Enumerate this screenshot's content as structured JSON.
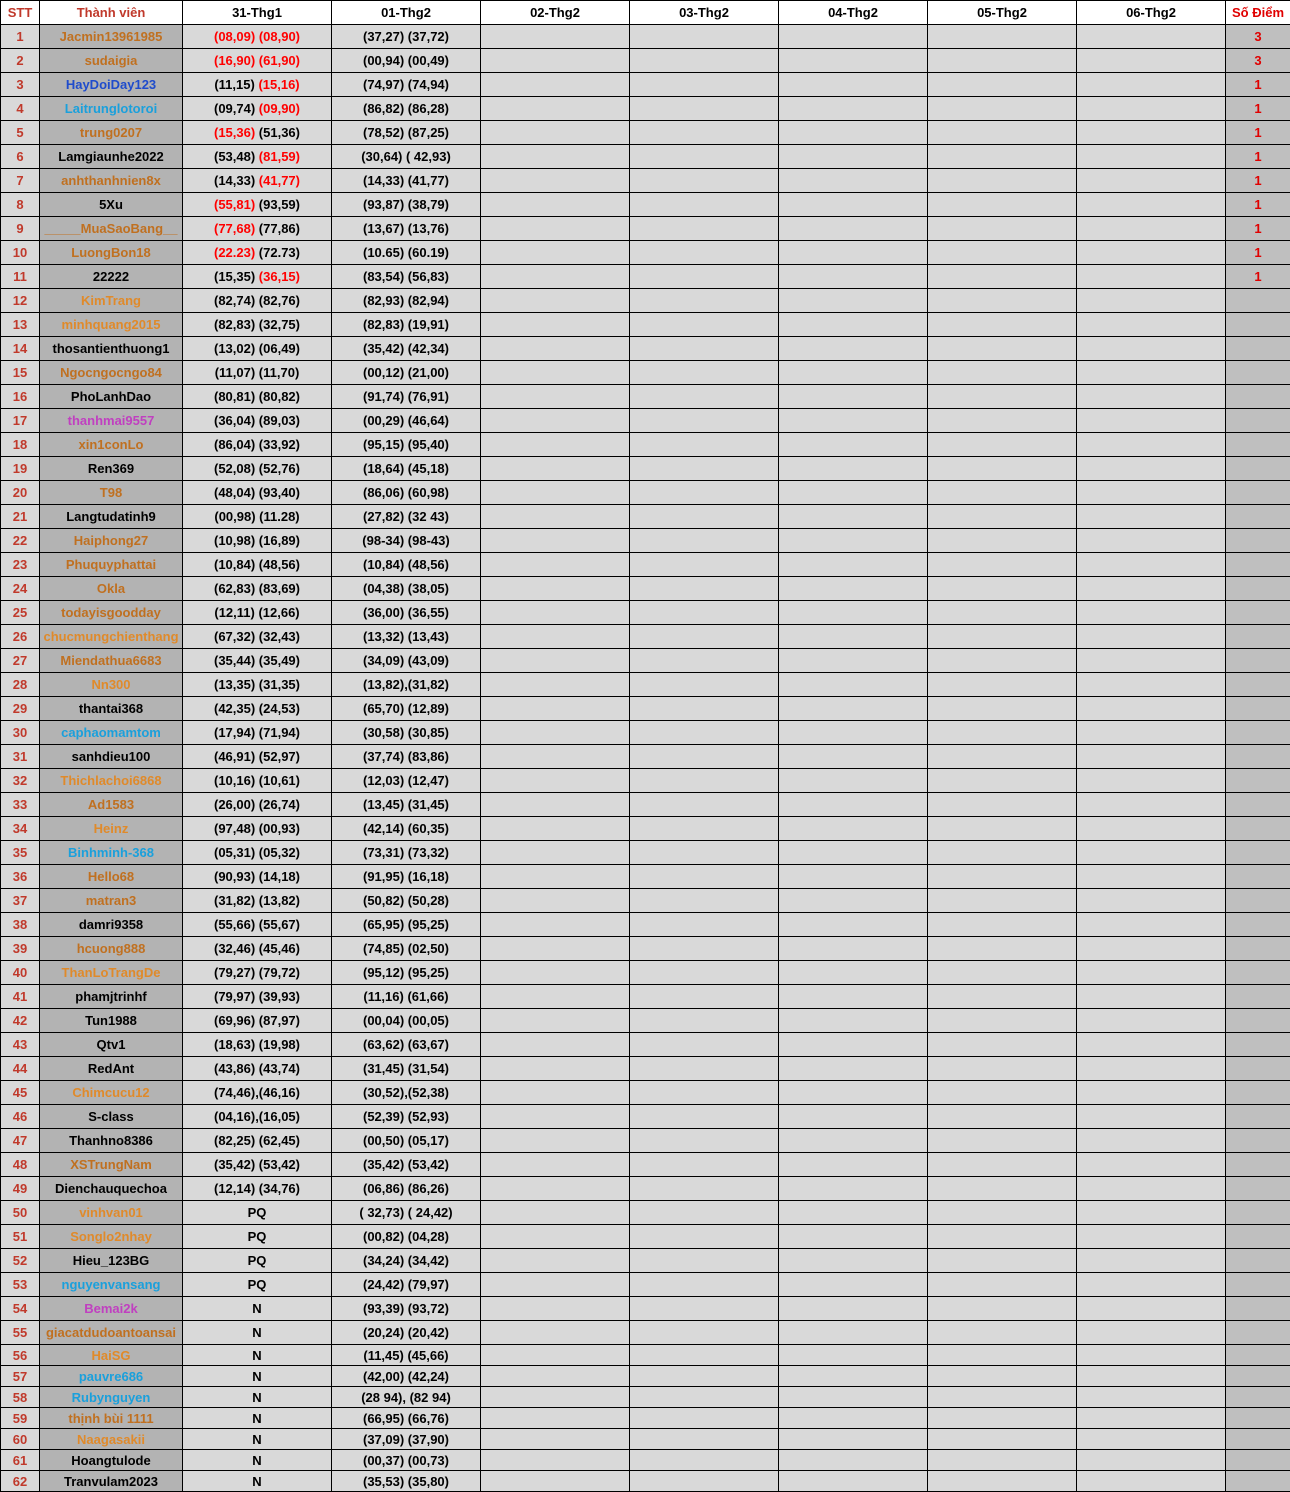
{
  "colors": {
    "stt": "#c0392b",
    "orange": "#c07020",
    "light_orange": "#e08a2a",
    "blue": "#1f4ccc",
    "cyan": "#1aa0dc",
    "magenta": "#c040c0",
    "black": "#000000",
    "red": "#ff0000"
  },
  "headers": [
    "STT",
    "Thành viên",
    "31-Thg1",
    "01-Thg2",
    "02-Thg2",
    "03-Thg2",
    "04-Thg2",
    "05-Thg2",
    "06-Thg2",
    "Số Điểm"
  ],
  "rows": [
    {
      "stt": "1",
      "name": "Jacmin13961985",
      "color": "orange",
      "d1": [
        {
          "t": "(08,09)",
          "r": true
        },
        {
          "t": " "
        },
        {
          "t": "(08,90)",
          "r": true
        }
      ],
      "d2": "(37,27) (37,72)",
      "pts": "3"
    },
    {
      "stt": "2",
      "name": "sudaigia",
      "color": "orange",
      "d1": [
        {
          "t": "(16,90) (61,90)",
          "r": true
        }
      ],
      "d2": "(00,94) (00,49)",
      "pts": "3"
    },
    {
      "stt": "3",
      "name": "HayDoiDay123",
      "color": "blue",
      "d1": [
        {
          "t": "(11,15) "
        },
        {
          "t": "(15,16)",
          "r": true
        }
      ],
      "d2": "(74,97) (74,94)",
      "pts": "1"
    },
    {
      "stt": "4",
      "name": "Laitrunglotoroi",
      "color": "cyan",
      "d1": [
        {
          "t": "(09,74) "
        },
        {
          "t": "(09,90)",
          "r": true
        }
      ],
      "d2": "(86,82) (86,28)",
      "pts": "1"
    },
    {
      "stt": "5",
      "name": "trung0207",
      "color": "orange",
      "d1": [
        {
          "t": "(15,36)",
          "r": true
        },
        {
          "t": " (51,36)"
        }
      ],
      "d2": "(78,52) (87,25)",
      "pts": "1"
    },
    {
      "stt": "6",
      "name": "Lamgiaunhe2022",
      "color": "black",
      "d1": [
        {
          "t": "(53,48) "
        },
        {
          "t": "(81,59)",
          "r": true
        }
      ],
      "d2": "(30,64) ( 42,93)",
      "pts": "1"
    },
    {
      "stt": "7",
      "name": "anhthanhnien8x",
      "color": "orange",
      "d1": [
        {
          "t": "(14,33) "
        },
        {
          "t": "(41,77)",
          "r": true
        }
      ],
      "d2": "(14,33) (41,77)",
      "pts": "1"
    },
    {
      "stt": "8",
      "name": "5Xu",
      "color": "black",
      "d1": [
        {
          "t": "(55,81)",
          "r": true
        },
        {
          "t": " (93,59)"
        }
      ],
      "d2": "(93,87) (38,79)",
      "pts": "1"
    },
    {
      "stt": "9",
      "name": "_____MuaSaoBang__",
      "color": "orange",
      "d1": [
        {
          "t": "(77,68)",
          "r": true
        },
        {
          "t": " (77,86)"
        }
      ],
      "d2": "(13,67) (13,76)",
      "pts": "1"
    },
    {
      "stt": "10",
      "name": "LuongBon18",
      "color": "orange",
      "d1": [
        {
          "t": "(22.23)",
          "r": true
        },
        {
          "t": " (72.73)"
        }
      ],
      "d2": "(10.65) (60.19)",
      "pts": "1"
    },
    {
      "stt": "11",
      "name": "22222",
      "color": "black",
      "d1": [
        {
          "t": "(15,35) "
        },
        {
          "t": "(36,15)",
          "r": true
        }
      ],
      "d2": "(83,54) (56,83)",
      "pts": "1"
    },
    {
      "stt": "12",
      "name": "KimTrang",
      "color": "light_orange",
      "d1": [
        {
          "t": "(82,74) (82,76)"
        }
      ],
      "d2": "(82,93) (82,94)",
      "pts": ""
    },
    {
      "stt": "13",
      "name": "minhquang2015",
      "color": "light_orange",
      "d1": [
        {
          "t": "(82,83) (32,75)"
        }
      ],
      "d2": "(82,83) (19,91)",
      "pts": ""
    },
    {
      "stt": "14",
      "name": "thosantienthuong1",
      "color": "black",
      "d1": [
        {
          "t": "(13,02) (06,49)"
        }
      ],
      "d2": "(35,42) (42,34)",
      "pts": ""
    },
    {
      "stt": "15",
      "name": "Ngocngocngo84",
      "color": "orange",
      "d1": [
        {
          "t": "(11,07) (11,70)"
        }
      ],
      "d2": "(00,12) (21,00)",
      "pts": ""
    },
    {
      "stt": "16",
      "name": "PhoLanhDao",
      "color": "black",
      "d1": [
        {
          "t": "(80,81) (80,82)"
        }
      ],
      "d2": "(91,74) (76,91)",
      "pts": ""
    },
    {
      "stt": "17",
      "name": "thanhmai9557",
      "color": "magenta",
      "d1": [
        {
          "t": "(36,04) (89,03)"
        }
      ],
      "d2": "(00,29) (46,64)",
      "pts": ""
    },
    {
      "stt": "18",
      "name": "xin1conLo",
      "color": "orange",
      "d1": [
        {
          "t": "(86,04) (33,92)"
        }
      ],
      "d2": "(95,15) (95,40)",
      "pts": ""
    },
    {
      "stt": "19",
      "name": "Ren369",
      "color": "black",
      "d1": [
        {
          "t": "(52,08) (52,76)"
        }
      ],
      "d2": "(18,64) (45,18)",
      "pts": ""
    },
    {
      "stt": "20",
      "name": "T98",
      "color": "orange",
      "d1": [
        {
          "t": "(48,04) (93,40)"
        }
      ],
      "d2": "(86,06) (60,98)",
      "pts": ""
    },
    {
      "stt": "21",
      "name": "Langtudatinh9",
      "color": "black",
      "d1": [
        {
          "t": "(00,98) (11.28)"
        }
      ],
      "d2": "(27,82) (32 43)",
      "pts": ""
    },
    {
      "stt": "22",
      "name": "Haiphong27",
      "color": "orange",
      "d1": [
        {
          "t": "(10,98) (16,89)"
        }
      ],
      "d2": "(98-34) (98-43)",
      "pts": ""
    },
    {
      "stt": "23",
      "name": "Phuquyphattai",
      "color": "orange",
      "d1": [
        {
          "t": "(10,84) (48,56)"
        }
      ],
      "d2": "(10,84) (48,56)",
      "pts": ""
    },
    {
      "stt": "24",
      "name": "Okla",
      "color": "orange",
      "d1": [
        {
          "t": "(62,83) (83,69)"
        }
      ],
      "d2": "(04,38) (38,05)",
      "pts": ""
    },
    {
      "stt": "25",
      "name": "todayisgoodday",
      "color": "orange",
      "d1": [
        {
          "t": "(12,11) (12,66)"
        }
      ],
      "d2": "(36,00) (36,55)",
      "pts": ""
    },
    {
      "stt": "26",
      "name": "chucmungchienthang",
      "color": "light_orange",
      "d1": [
        {
          "t": "(67,32) (32,43)"
        }
      ],
      "d2": "(13,32) (13,43)",
      "pts": ""
    },
    {
      "stt": "27",
      "name": "Miendathua6683",
      "color": "orange",
      "d1": [
        {
          "t": "(35,44) (35,49)"
        }
      ],
      "d2": "(34,09) (43,09)",
      "pts": ""
    },
    {
      "stt": "28",
      "name": "Nn300",
      "color": "light_orange",
      "d1": [
        {
          "t": "(13,35) (31,35)"
        }
      ],
      "d2": "(13,82),(31,82)",
      "pts": ""
    },
    {
      "stt": "29",
      "name": "thantai368",
      "color": "black",
      "d1": [
        {
          "t": "(42,35) (24,53)"
        }
      ],
      "d2": "(65,70) (12,89)",
      "pts": ""
    },
    {
      "stt": "30",
      "name": "caphaomamtom",
      "color": "cyan",
      "d1": [
        {
          "t": "(17,94) (71,94)"
        }
      ],
      "d2": "(30,58) (30,85)",
      "pts": ""
    },
    {
      "stt": "31",
      "name": "sanhdieu100",
      "color": "black",
      "d1": [
        {
          "t": "(46,91) (52,97)"
        }
      ],
      "d2": "(37,74) (83,86)",
      "pts": ""
    },
    {
      "stt": "32",
      "name": "Thichlachoi6868",
      "color": "light_orange",
      "d1": [
        {
          "t": "(10,16) (10,61)"
        }
      ],
      "d2": "(12,03) (12,47)",
      "pts": ""
    },
    {
      "stt": "33",
      "name": "Ad1583",
      "color": "orange",
      "d1": [
        {
          "t": "(26,00) (26,74)"
        }
      ],
      "d2": "(13,45) (31,45)",
      "pts": ""
    },
    {
      "stt": "34",
      "name": "Heinz",
      "color": "light_orange",
      "d1": [
        {
          "t": "(97,48) (00,93)"
        }
      ],
      "d2": "(42,14) (60,35)",
      "pts": ""
    },
    {
      "stt": "35",
      "name": "Binhminh-368",
      "color": "cyan",
      "d1": [
        {
          "t": "(05,31) (05,32)"
        }
      ],
      "d2": "(73,31) (73,32)",
      "pts": ""
    },
    {
      "stt": "36",
      "name": "Hello68",
      "color": "orange",
      "d1": [
        {
          "t": "(90,93) (14,18)"
        }
      ],
      "d2": "(91,95) (16,18)",
      "pts": ""
    },
    {
      "stt": "37",
      "name": "matran3",
      "color": "orange",
      "d1": [
        {
          "t": "(31,82) (13,82)"
        }
      ],
      "d2": "(50,82) (50,28)",
      "pts": ""
    },
    {
      "stt": "38",
      "name": "damri9358",
      "color": "black",
      "d1": [
        {
          "t": "(55,66) (55,67)"
        }
      ],
      "d2": "(65,95) (95,25)",
      "pts": ""
    },
    {
      "stt": "39",
      "name": "hcuong888",
      "color": "orange",
      "d1": [
        {
          "t": "(32,46) (45,46)"
        }
      ],
      "d2": "(74,85) (02,50)",
      "pts": ""
    },
    {
      "stt": "40",
      "name": "ThanLoTrangDe",
      "color": "light_orange",
      "d1": [
        {
          "t": "(79,27) (79,72)"
        }
      ],
      "d2": "(95,12) (95,25)",
      "pts": ""
    },
    {
      "stt": "41",
      "name": "phamjtrinhf",
      "color": "black",
      "d1": [
        {
          "t": "(79,97) (39,93)"
        }
      ],
      "d2": "(11,16) (61,66)",
      "pts": ""
    },
    {
      "stt": "42",
      "name": "Tun1988",
      "color": "black",
      "d1": [
        {
          "t": "(69,96) (87,97)"
        }
      ],
      "d2": "(00,04) (00,05)",
      "pts": ""
    },
    {
      "stt": "43",
      "name": "Qtv1",
      "color": "black",
      "d1": [
        {
          "t": "(18,63) (19,98)"
        }
      ],
      "d2": "(63,62) (63,67)",
      "pts": ""
    },
    {
      "stt": "44",
      "name": "RedAnt",
      "color": "black",
      "d1": [
        {
          "t": "(43,86) (43,74)"
        }
      ],
      "d2": "(31,45) (31,54)",
      "pts": ""
    },
    {
      "stt": "45",
      "name": "Chimcucu12",
      "color": "light_orange",
      "d1": [
        {
          "t": "(74,46),(46,16)"
        }
      ],
      "d2": "(30,52),(52,38)",
      "pts": ""
    },
    {
      "stt": "46",
      "name": "S-class",
      "color": "black",
      "d1": [
        {
          "t": "(04,16),(16,05)"
        }
      ],
      "d2": "(52,39) (52,93)",
      "pts": ""
    },
    {
      "stt": "47",
      "name": "Thanhno8386",
      "color": "black",
      "d1": [
        {
          "t": "(82,25) (62,45)"
        }
      ],
      "d2": "(00,50) (05,17)",
      "pts": ""
    },
    {
      "stt": "48",
      "name": "XSTrungNam",
      "color": "orange",
      "d1": [
        {
          "t": "(35,42) (53,42)"
        }
      ],
      "d2": "(35,42) (53,42)",
      "pts": ""
    },
    {
      "stt": "49",
      "name": "Dienchauquechoa",
      "color": "black",
      "d1": [
        {
          "t": "(12,14) (34,76)"
        }
      ],
      "d2": "(06,86) (86,26)",
      "pts": ""
    },
    {
      "stt": "50",
      "name": "vinhvan01",
      "color": "light_orange",
      "d1": [
        {
          "t": "PQ"
        }
      ],
      "d2": "( 32,73) ( 24,42)",
      "pts": ""
    },
    {
      "stt": "51",
      "name": "Songlo2nhay",
      "color": "light_orange",
      "d1": [
        {
          "t": "PQ"
        }
      ],
      "d2": "(00,82) (04,28)",
      "pts": ""
    },
    {
      "stt": "52",
      "name": "Hieu_123BG",
      "color": "black",
      "d1": [
        {
          "t": "PQ"
        }
      ],
      "d2": "(34,24) (34,42)",
      "pts": ""
    },
    {
      "stt": "53",
      "name": "nguyenvansang",
      "color": "cyan",
      "d1": [
        {
          "t": "PQ"
        }
      ],
      "d2": "(24,42) (79,97)",
      "pts": ""
    },
    {
      "stt": "54",
      "name": "Bemai2k",
      "color": "magenta",
      "d1": [
        {
          "t": "N"
        }
      ],
      "d2": "(93,39) (93,72)",
      "pts": ""
    },
    {
      "stt": "55",
      "name": "giacatdudoantoansai",
      "color": "orange",
      "d1": [
        {
          "t": "N"
        }
      ],
      "d2": "(20,24) (20,42)",
      "pts": ""
    },
    {
      "stt": "56",
      "name": "HaiSG",
      "color": "light_orange",
      "d1": [
        {
          "t": "N"
        }
      ],
      "d2": "(11,45) (45,66)",
      "pts": ""
    },
    {
      "stt": "57",
      "name": "pauvre686",
      "color": "cyan",
      "d1": [
        {
          "t": "N"
        }
      ],
      "d2": "(42,00) (42,24)",
      "pts": ""
    },
    {
      "stt": "58",
      "name": "Rubynguyen",
      "color": "cyan",
      "d1": [
        {
          "t": "N"
        }
      ],
      "d2": "(28 94), (82 94)",
      "pts": ""
    },
    {
      "stt": "59",
      "name": "thịnh bùi 1111",
      "color": "orange",
      "d1": [
        {
          "t": "N"
        }
      ],
      "d2": "(66,95) (66,76)",
      "pts": ""
    },
    {
      "stt": "60",
      "name": "Naagasakii",
      "color": "light_orange",
      "d1": [
        {
          "t": "N"
        }
      ],
      "d2": "(37,09) (37,90)",
      "pts": ""
    },
    {
      "stt": "61",
      "name": "Hoangtulode",
      "color": "black",
      "d1": [
        {
          "t": "N"
        }
      ],
      "d2": "(00,37) (00,73)",
      "pts": ""
    },
    {
      "stt": "62",
      "name": "Tranvulam2023",
      "color": "black",
      "d1": [
        {
          "t": "N"
        }
      ],
      "d2": "(35,53) (35,80)",
      "pts": ""
    }
  ]
}
